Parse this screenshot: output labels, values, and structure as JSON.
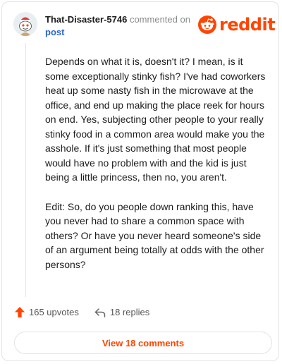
{
  "header": {
    "username": "That-Disaster-5746",
    "commented_on": "commented on",
    "post_link": "post",
    "logo_text": "reddit"
  },
  "comment": {
    "paragraphs": [
      "Depends on what it is, doesn't it? I mean, is it some exceptionally stinky fish? I've had coworkers heat up some nasty fish in the microwave at the office, and end up making the place reek for hours on end. Yes, subjecting other people to your really stinky food in a common area would make you the asshole. If it's just something that most people would have no problem with and the kid is just being a little princess, then no, you aren't.",
      "Edit: So, do you people down ranking this, have you never had to share a common space with others? Or have you never heard someone's side of an argument being totally at odds with the other persons?"
    ]
  },
  "actions": {
    "upvotes": "165 upvotes",
    "replies": "18 replies"
  },
  "view_button": "View 18 comments",
  "icons": {
    "avatar": "snoo-avatar-icon",
    "logo": "reddit-snoo-icon",
    "upvote": "upvote-arrow-icon",
    "reply": "reply-arrow-icon"
  },
  "colors": {
    "brand": "#ff4500",
    "link": "#2a66c9",
    "muted": "#878a8c"
  }
}
